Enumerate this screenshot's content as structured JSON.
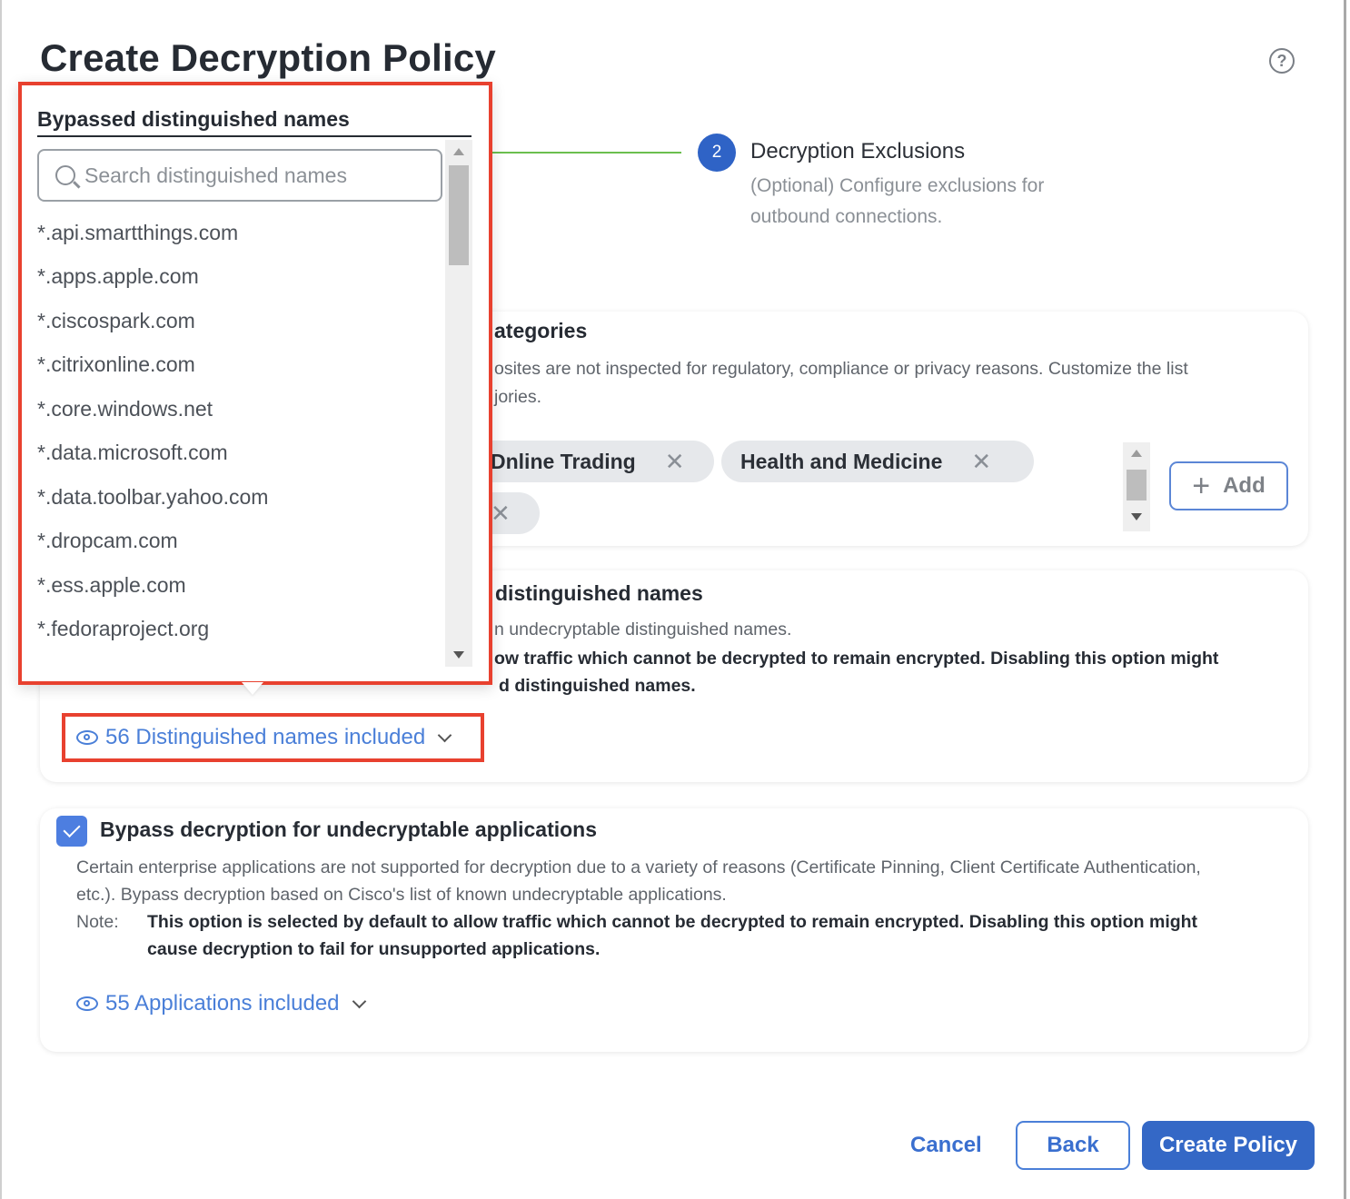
{
  "header": {
    "title": "Create Decryption Policy",
    "help_icon": "help-circle-icon"
  },
  "stepper": {
    "step_number": "2",
    "step_title": "Decryption Exclusions",
    "step_description": "(Optional) Configure exclusions for outbound connections."
  },
  "categories_card": {
    "title_partial": "ategories",
    "desc_line1_partial": "osites are not inspected for regulatory, compliance or privacy reasons. Customize the list",
    "desc_line2_partial": "jories.",
    "chips": [
      {
        "label": "Online Trading",
        "visible_label": "Dnline Trading",
        "remove_icon": "close-icon"
      },
      {
        "label": "Health and Medicine",
        "visible_label": "Health and Medicine",
        "remove_icon": "close-icon"
      },
      {
        "label": "",
        "visible_label": "",
        "remove_icon": "close-icon"
      }
    ],
    "add_button": "Add"
  },
  "distinguished_names_card": {
    "title_partial": "distinguished names",
    "desc_partial": "n undecryptable distinguished names.",
    "note_line1_partial": "ow traffic which cannot be decrypted to remain encrypted. Disabling this option might",
    "note_line2_partial": "d distinguished names.",
    "included_link": "56 Distinguished names included"
  },
  "applications_card": {
    "checkbox_checked": true,
    "title": "Bypass decryption for undecryptable applications",
    "description": "Certain enterprise applications are not supported for decryption due to a variety of reasons (Certificate Pinning, Client Certificate Authentication, etc.). Bypass decryption based on Cisco's list of known undecryptable applications.",
    "note_label": "Note:",
    "note_line1": "This option is selected by default to allow traffic which cannot be decrypted to remain encrypted. Disabling this option might",
    "note_line2": "cause decryption to fail for unsupported applications.",
    "included_link": "55 Applications included"
  },
  "popover": {
    "title": "Bypassed distinguished names",
    "search_placeholder": "Search distinguished names",
    "search_value": "",
    "items": [
      "*.api.smartthings.com",
      "*.apps.apple.com",
      "*.ciscospark.com",
      "*.citrixonline.com",
      "*.core.windows.net",
      "*.data.microsoft.com",
      "*.data.toolbar.yahoo.com",
      "*.dropcam.com",
      "*.ess.apple.com",
      "*.fedoraproject.org"
    ]
  },
  "footer": {
    "cancel": "Cancel",
    "back": "Back",
    "create": "Create Policy"
  },
  "colors": {
    "primary": "#3468c6",
    "link": "#4a7fd8",
    "highlight": "#e8412f",
    "step_line": "#6bbf4e",
    "checkbox": "#4d7ee0"
  }
}
